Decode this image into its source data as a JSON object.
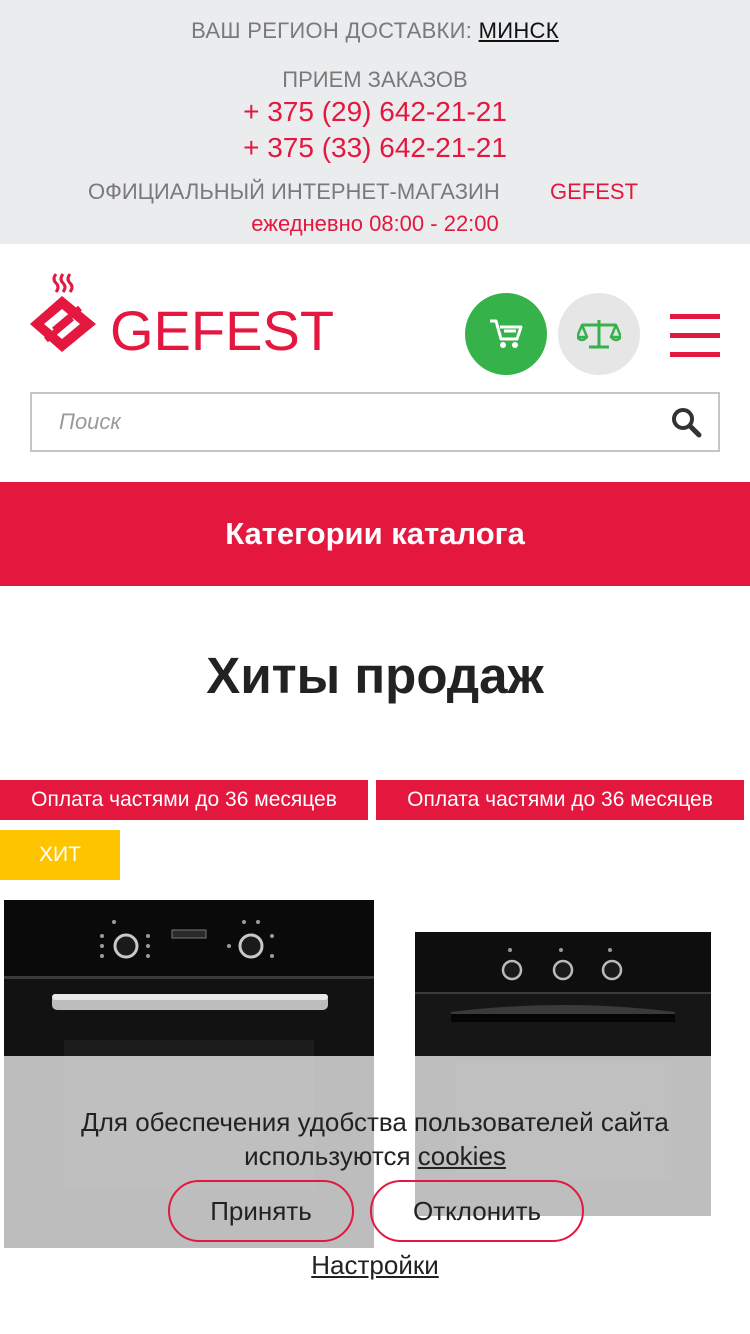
{
  "top_bar": {
    "region_label": "ВАШ РЕГИОН ДОСТАВКИ:",
    "region_value": "МИНСК",
    "orders_label": "ПРИЕМ ЗАКАЗОВ",
    "phone_1": "+ 375 (29) 642-21-21",
    "phone_2": "+ 375 (33) 642-21-21",
    "official_label": "ОФИЦИАЛЬНЫЙ ИНТЕРНЕТ-МАГАЗИН",
    "official_brand": "GEFEST",
    "hours": "ежедневно 08:00 - 22:00"
  },
  "header": {
    "logo_text": "GEFEST",
    "cart_icon": "cart-icon",
    "compare_icon": "scales-icon",
    "menu_icon": "hamburger-icon"
  },
  "search": {
    "placeholder": "Поиск",
    "value": "",
    "icon": "search-icon"
  },
  "catalog_button": {
    "label": "Категории каталога"
  },
  "hits": {
    "title": "Хиты продаж",
    "products": [
      {
        "badge": "Оплата частями до 36 месяцев",
        "tag": "ХИТ"
      },
      {
        "badge": "Оплата частями до 36 месяцев"
      }
    ]
  },
  "cookie_banner": {
    "text_before": "Для обеспечения удобства пользователей сайта используются",
    "link": "cookies",
    "accept": "Принять",
    "decline": "Отклонить",
    "settings": "Настройки"
  },
  "colors": {
    "brand_red": "#e4173f",
    "cart_green": "#36b24a",
    "hit_yellow": "#fec400",
    "topbar_bg": "#ebecee"
  }
}
